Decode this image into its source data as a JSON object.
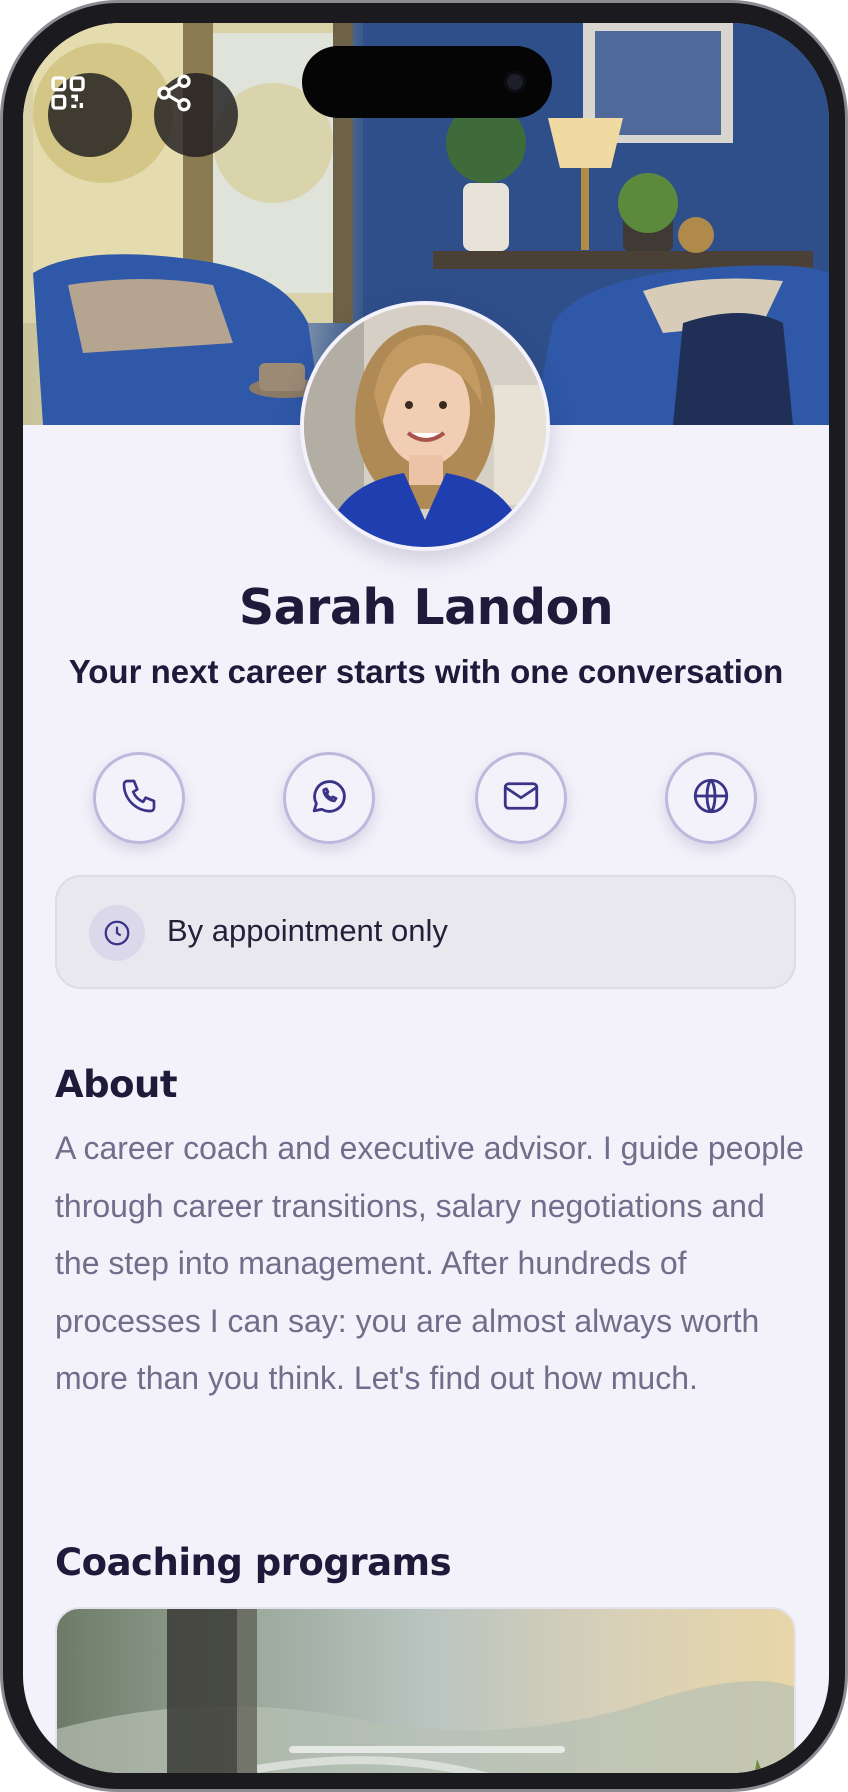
{
  "profile": {
    "name": "Sarah Landon",
    "tagline": "Your next career starts with one conversation"
  },
  "header": {
    "qr_icon": "qr-code-icon",
    "share_icon": "share-icon"
  },
  "contacts": [
    {
      "icon": "phone-icon"
    },
    {
      "icon": "whatsapp-icon"
    },
    {
      "icon": "mail-icon"
    },
    {
      "icon": "globe-icon"
    }
  ],
  "hours": {
    "icon": "clock-icon",
    "label": "By appointment only"
  },
  "about": {
    "title": "About",
    "text": "A career coach and executive advisor. I guide people through career transitions, salary negotiations and the step into management. After hundreds of processes I can say: you are almost always worth more than you think. Let's find out how much."
  },
  "programs": {
    "title": "Coaching programs"
  },
  "colors": {
    "accent": "#3b3486",
    "background": "#f3f2fa",
    "text_primary": "#1e1b3a",
    "text_secondary": "#726d8a"
  }
}
